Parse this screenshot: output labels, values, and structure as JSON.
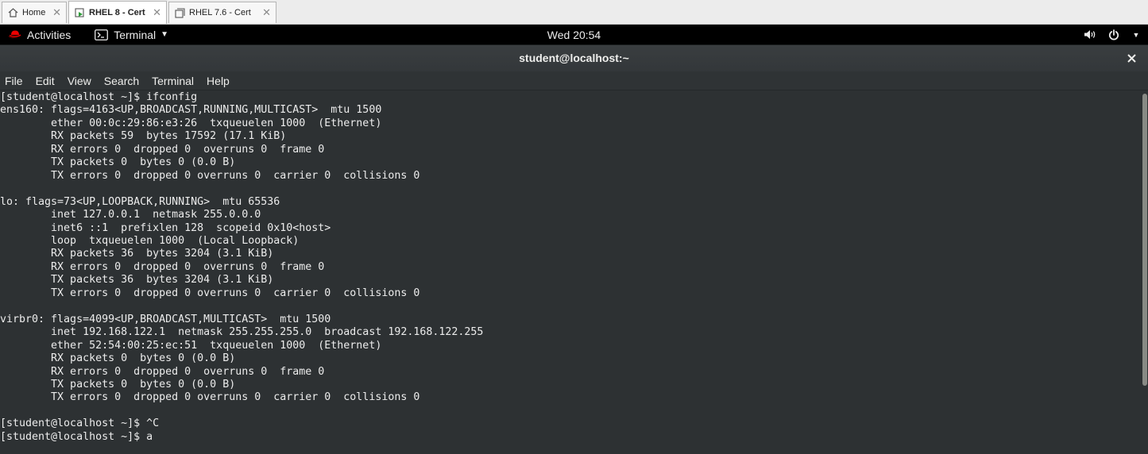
{
  "vm_tabs": [
    {
      "label": "Home",
      "icon": "home-icon",
      "active": false
    },
    {
      "label": "RHEL 8 - Cert",
      "icon": "vm-running-icon",
      "active": true
    },
    {
      "label": "RHEL 7.6  - Cert",
      "icon": "vm-icon",
      "active": false
    }
  ],
  "topbar": {
    "activities": "Activities",
    "app_name": "Terminal",
    "clock": "Wed 20:54"
  },
  "window": {
    "title": "student@localhost:~"
  },
  "menu": [
    "File",
    "Edit",
    "View",
    "Search",
    "Terminal",
    "Help"
  ],
  "terminal_lines": [
    "[student@localhost ~]$ ifconfig",
    "ens160: flags=4163<UP,BROADCAST,RUNNING,MULTICAST>  mtu 1500",
    "        ether 00:0c:29:86:e3:26  txqueuelen 1000  (Ethernet)",
    "        RX packets 59  bytes 17592 (17.1 KiB)",
    "        RX errors 0  dropped 0  overruns 0  frame 0",
    "        TX packets 0  bytes 0 (0.0 B)",
    "        TX errors 0  dropped 0 overruns 0  carrier 0  collisions 0",
    "",
    "lo: flags=73<UP,LOOPBACK,RUNNING>  mtu 65536",
    "        inet 127.0.0.1  netmask 255.0.0.0",
    "        inet6 ::1  prefixlen 128  scopeid 0x10<host>",
    "        loop  txqueuelen 1000  (Local Loopback)",
    "        RX packets 36  bytes 3204 (3.1 KiB)",
    "        RX errors 0  dropped 0  overruns 0  frame 0",
    "        TX packets 36  bytes 3204 (3.1 KiB)",
    "        TX errors 0  dropped 0 overruns 0  carrier 0  collisions 0",
    "",
    "virbr0: flags=4099<UP,BROADCAST,MULTICAST>  mtu 1500",
    "        inet 192.168.122.1  netmask 255.255.255.0  broadcast 192.168.122.255",
    "        ether 52:54:00:25:ec:51  txqueuelen 1000  (Ethernet)",
    "        RX packets 0  bytes 0 (0.0 B)",
    "        RX errors 0  dropped 0  overruns 0  frame 0",
    "        TX packets 0  bytes 0 (0.0 B)",
    "        TX errors 0  dropped 0 overruns 0  carrier 0  collisions 0",
    "",
    "[student@localhost ~]$ ^C",
    "[student@localhost ~]$ a"
  ],
  "colors": {
    "terminal_bg": "#2d3133",
    "terminal_fg": "#ececec",
    "topbar_bg": "#000000",
    "redhat_red": "#ee0000"
  },
  "icons": {
    "activities": "redhat-icon",
    "app": "terminal-icon",
    "volume": "volume-icon",
    "power": "power-icon",
    "close": "close-icon"
  }
}
